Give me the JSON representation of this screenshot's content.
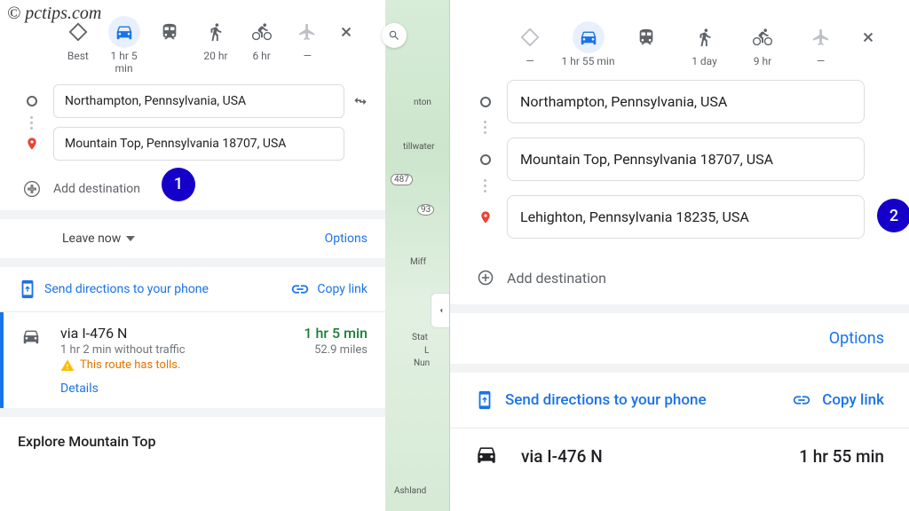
{
  "watermark": "© pctips.com",
  "left": {
    "modes": {
      "best": {
        "label": "Best"
      },
      "car": {
        "label": "1 hr 5 min",
        "selected": true
      },
      "transit": {
        "label": ""
      },
      "walk": {
        "label": "20 hr"
      },
      "bike": {
        "label": "6 hr"
      },
      "plane": {
        "label": "—"
      }
    },
    "waypoints": {
      "origin": "Northampton, Pennsylvania, USA",
      "destination": "Mountain Top, Pennsylvania 18707, USA"
    },
    "add_destination": "Add destination",
    "leave_now": "Leave now",
    "options": "Options",
    "send_phone": "Send directions to your phone",
    "copy_link": "Copy link",
    "route": {
      "name": "via I-476 N",
      "time": "1 hr 5 min",
      "no_traffic": "1 hr 2 min without traffic",
      "distance": "52.9 miles",
      "toll_note": "This route has tolls.",
      "details": "Details"
    },
    "explore": "Explore Mountain Top",
    "badge": "1",
    "map_labels": {
      "a": "nton",
      "b": "tillwater",
      "c": "Miff",
      "d": "Stat",
      "e": "L",
      "f": "Nun",
      "g": "Ashland",
      "r1": "487",
      "r2": "93"
    }
  },
  "right": {
    "modes": {
      "best": {
        "label": "—"
      },
      "car": {
        "label": "1 hr 55 min",
        "selected": true
      },
      "transit": {
        "label": ""
      },
      "walk": {
        "label": "1 day"
      },
      "bike": {
        "label": "9 hr"
      },
      "plane": {
        "label": "—"
      }
    },
    "waypoints": {
      "stop1": "Northampton, Pennsylvania, USA",
      "stop2": "Mountain Top, Pennsylvania 18707, USA",
      "stop3": "Lehighton, Pennsylvania 18235, USA"
    },
    "add_destination": "Add destination",
    "options": "Options",
    "send_phone": "Send directions to your phone",
    "copy_link": "Copy link",
    "route": {
      "name": "via I-476 N",
      "time": "1 hr 55 min"
    },
    "badge": "2"
  }
}
